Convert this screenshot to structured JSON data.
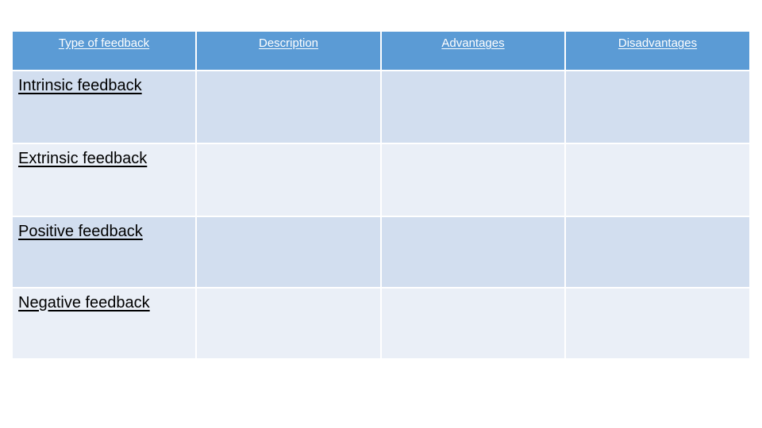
{
  "colors": {
    "header_bg": "#5B9BD5",
    "row_odd_bg": "#D2DEEF",
    "row_even_bg": "#EAEFF7",
    "header_text": "#FFFFFF"
  },
  "table": {
    "headers": [
      "Type of feedback",
      "Description",
      "Advantages",
      "Disadvantages"
    ],
    "rows": [
      {
        "type": "Intrinsic feedback",
        "description": "",
        "advantages": "",
        "disadvantages": ""
      },
      {
        "type": "Extrinsic feedback",
        "description": "",
        "advantages": "",
        "disadvantages": ""
      },
      {
        "type": "Positive feedback",
        "description": "",
        "advantages": "",
        "disadvantages": ""
      },
      {
        "type": "Negative feedback",
        "description": "",
        "advantages": "",
        "disadvantages": ""
      }
    ]
  }
}
